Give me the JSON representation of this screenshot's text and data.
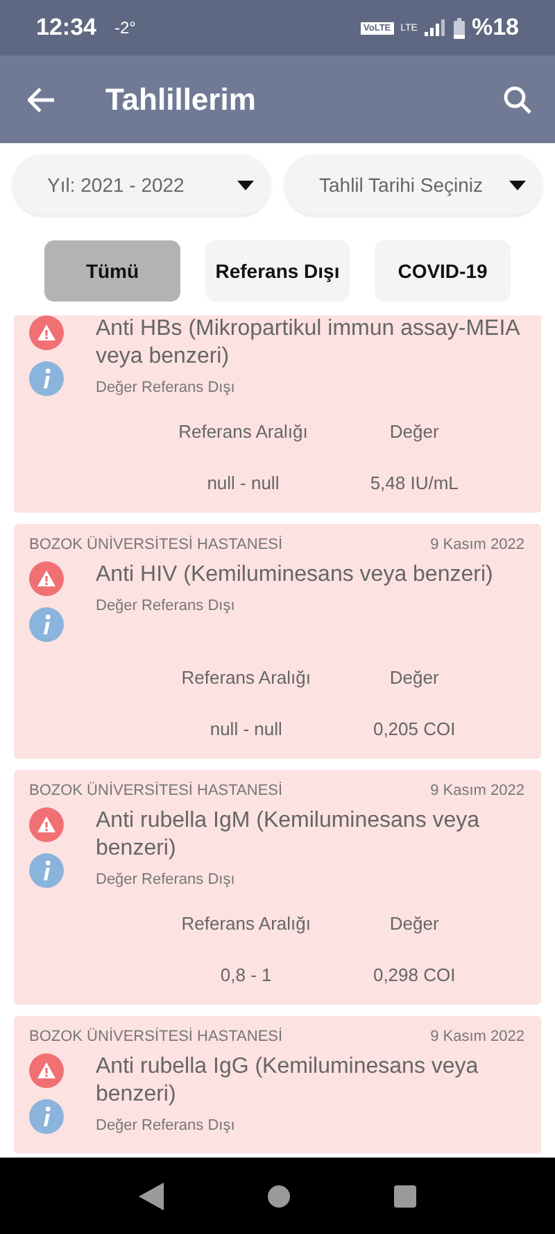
{
  "status_bar": {
    "time": "12:34",
    "temperature": "-2°",
    "volte": "VoLTE",
    "network": "LTE",
    "battery": "%18"
  },
  "app_bar": {
    "title": "Tahlillerim"
  },
  "filters": [
    {
      "label": "Yıl: 2021 - 2022"
    },
    {
      "label": "Tahlil Tarihi Seçiniz"
    }
  ],
  "tabs": [
    {
      "label": "Tümü",
      "selected": true
    },
    {
      "label": "Referans Dışı",
      "selected": false
    },
    {
      "label": "COVID-19",
      "selected": false
    }
  ],
  "results": [
    {
      "title": "Anti HBs (Mikropartikul immun assay-MEIA veya benzeri)",
      "status": "Değer Referans Dışı",
      "range_label": "Referans Aralığı",
      "value_label": "Değer",
      "range": "null - null",
      "value": "5,48 IU/mL"
    },
    {
      "hospital": "BOZOK ÜNİVERSİTESİ HASTANESİ",
      "date": "9 Kasım 2022",
      "title": "Anti HIV (Kemiluminesans veya benzeri)",
      "status": "Değer Referans Dışı",
      "range_label": "Referans Aralığı",
      "value_label": "Değer",
      "range": "null - null",
      "value": "0,205 COI"
    },
    {
      "hospital": "BOZOK ÜNİVERSİTESİ HASTANESİ",
      "date": "9 Kasım 2022",
      "title": "Anti rubella IgM (Kemiluminesans veya benzeri)",
      "status": "Değer Referans Dışı",
      "range_label": "Referans Aralığı",
      "value_label": "Değer",
      "range": "0,8 - 1",
      "value": "0,298 COI"
    },
    {
      "hospital": "BOZOK ÜNİVERSİTESİ HASTANESİ",
      "date": "9 Kasım 2022",
      "title": "Anti rubella IgG (Kemiluminesans veya benzeri)",
      "status": "Değer Referans Dışı"
    }
  ]
}
